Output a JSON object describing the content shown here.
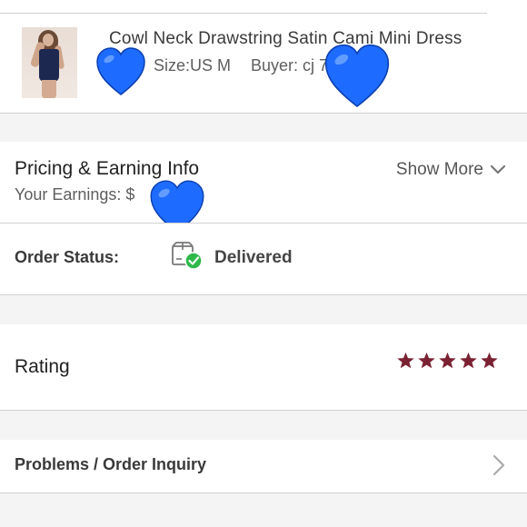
{
  "product": {
    "title": "Cowl Neck Drawstring Satin Cami Mini Dress",
    "size": "Size:US M",
    "buyer": "Buyer: cj                7"
  },
  "pricing": {
    "title": "Pricing & Earning Info",
    "earnings": "Your Earnings: $",
    "show_more": "Show More"
  },
  "order_status": {
    "label": "Order Status:",
    "value": "Delivered",
    "icon": "delivered-box-icon"
  },
  "rating": {
    "label": "Rating",
    "stars": 5,
    "star_color": "#7b2232"
  },
  "problems": {
    "label": "Problems / Order Inquiry"
  },
  "colors": {
    "heart": "#1e6cff",
    "check": "#2eb84a",
    "divider": "#cfcfcf",
    "background": "#f4f4f4"
  }
}
